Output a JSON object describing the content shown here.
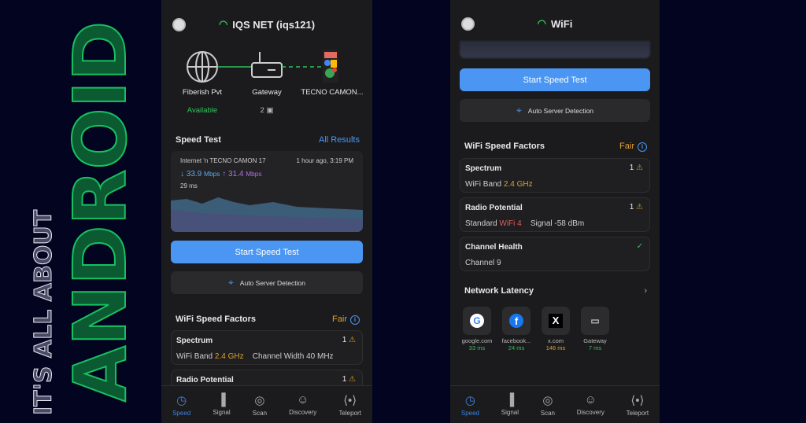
{
  "brand": {
    "tagline": "IT'S ALL ABOUT",
    "word": "ANDROID"
  },
  "phone1": {
    "network": "IQS NET (iqs121)",
    "topology": {
      "isp": "Fiberish Pvt",
      "isp_status": "Available",
      "gateway": "Gateway",
      "gateway_devices": "2",
      "device": "TECNO CAMON..."
    },
    "speed_test": {
      "title": "Speed Test",
      "all_results": "All Results",
      "source": "Internet 'n  TECNO CAMON 17",
      "time": "1 hour ago, 3:19 PM",
      "download": "33.9",
      "upload": "31.4",
      "unit": "Mbps",
      "latency": "29 ms"
    },
    "start_button": "Start Speed Test",
    "auto_server": "Auto Server Detection",
    "factors": {
      "title": "WiFi Speed Factors",
      "rating": "Fair",
      "spectrum": {
        "title": "Spectrum",
        "count": "1",
        "band_label": "WiFi Band",
        "band": "2.4 GHz",
        "width_label": "Channel Width 40 MHz"
      },
      "radio": {
        "title": "Radio Potential",
        "count": "1"
      }
    }
  },
  "phone2": {
    "network": "WiFi",
    "start_button": "Start Speed Test",
    "auto_server": "Auto Server Detection",
    "factors": {
      "title": "WiFi Speed Factors",
      "rating": "Fair",
      "spectrum": {
        "title": "Spectrum",
        "count": "1",
        "band_label": "WiFi Band",
        "band": "2.4 GHz"
      },
      "radio": {
        "title": "Radio Potential",
        "count": "1",
        "standard_label": "Standard",
        "standard": "WiFi 4",
        "signal": "Signal -58 dBm"
      },
      "channel": {
        "title": "Channel Health",
        "value": "Channel 9"
      }
    },
    "latency": {
      "title": "Network Latency",
      "items": [
        {
          "name": "google.com",
          "ms": "33 ms",
          "icon": "G"
        },
        {
          "name": "facebook...",
          "ms": "24 ms",
          "icon": "f"
        },
        {
          "name": "x.com",
          "ms": "146 ms",
          "icon": "X"
        },
        {
          "name": "Gateway",
          "ms": "7 ms",
          "icon": "router"
        }
      ]
    }
  },
  "nav": [
    "Speed",
    "Signal",
    "Scan",
    "Discovery",
    "Teleport"
  ],
  "colors": {
    "accent": "#4a96f2",
    "good": "#2ec55b",
    "warn": "#e0a030",
    "brand_green": "#16c060"
  }
}
